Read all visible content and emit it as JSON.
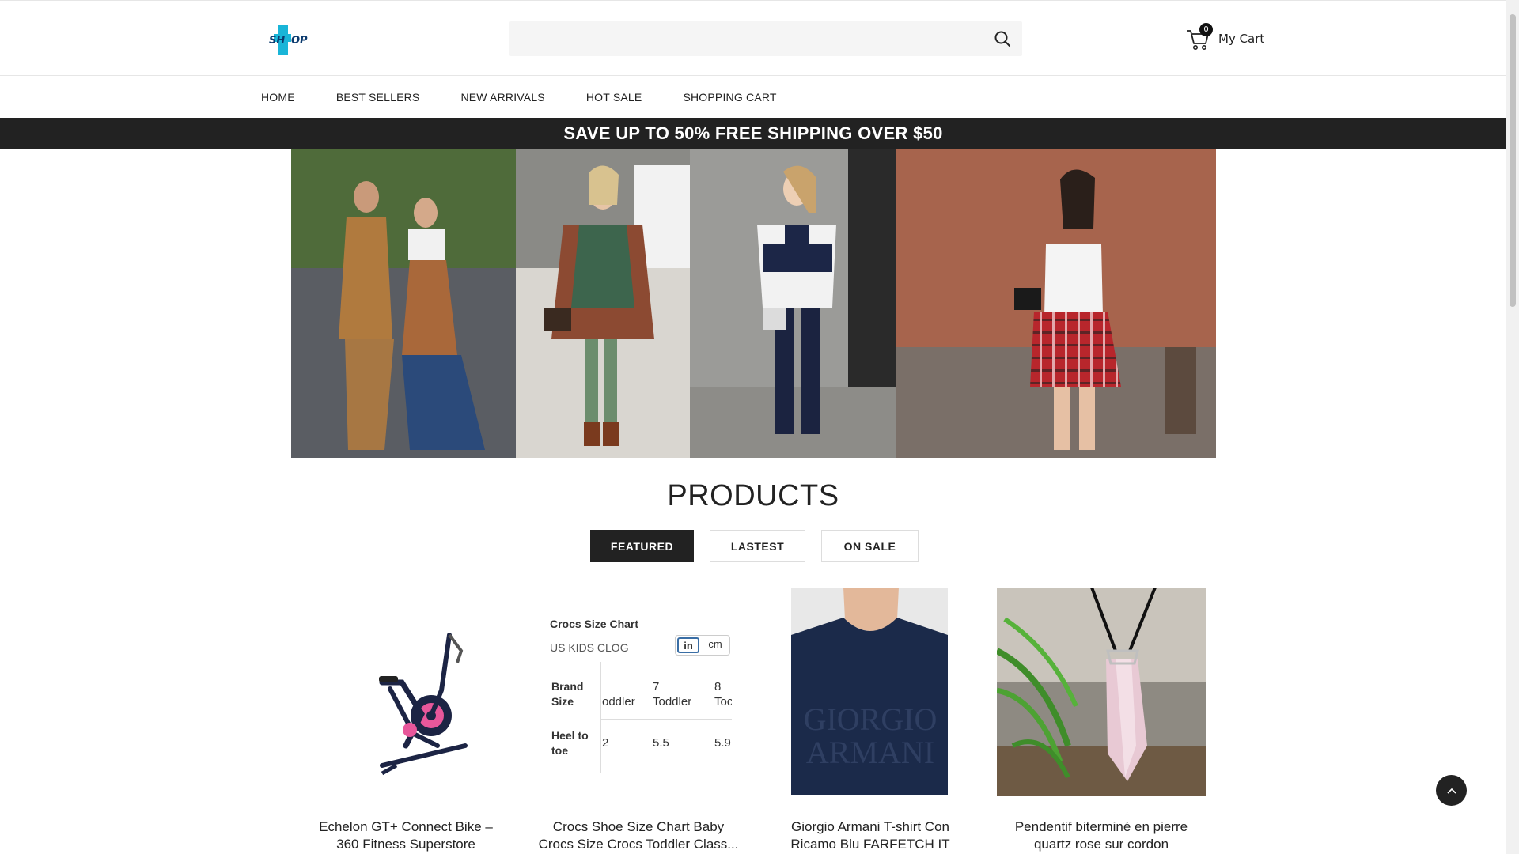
{
  "header": {
    "logo_alt": "SHOP",
    "search": {
      "placeholder": "",
      "value": ""
    },
    "cart": {
      "count": "0",
      "label": "My Cart"
    }
  },
  "nav": {
    "items": [
      {
        "label": "HOME"
      },
      {
        "label": "BEST SELLERS"
      },
      {
        "label": "NEW ARRIVALS"
      },
      {
        "label": "HOT SALE"
      },
      {
        "label": "SHOPPING CART"
      }
    ]
  },
  "promo": {
    "text": "SAVE UP TO 50% FREE SHIPPING OVER $50"
  },
  "products": {
    "title": "PRODUCTS",
    "tabs": [
      {
        "label": "FEATURED",
        "active": true
      },
      {
        "label": "LASTEST",
        "active": false
      },
      {
        "label": "ON SALE",
        "active": false
      }
    ],
    "items": [
      {
        "name_line1": "Echelon GT+ Connect Bike –",
        "name_line2": "360 Fitness Superstore",
        "rating": "★★★★★"
      },
      {
        "name_line1": "Crocs Shoe Size Chart Baby",
        "name_line2": "Crocs Size Crocs Toddler Class...",
        "rating": "★★★★★"
      },
      {
        "name_line1": "Giorgio Armani T-shirt Con",
        "name_line2": "Ricamo Blu FARFETCH IT",
        "rating": "★★★★★"
      },
      {
        "name_line1": "Pendentif biterminé en pierre",
        "name_line2": "quartz rose sur cordon",
        "rating": "★★★★★"
      }
    ],
    "size_chart": {
      "title": "Crocs Size Chart",
      "subtitle": "US KIDS CLOG",
      "unit_in": "in",
      "unit_cm": "cm",
      "row1_label_1": "Brand",
      "row1_label_2": "Size",
      "row2_label_1": "Heel to",
      "row2_label_2": "toe",
      "col1_top": "",
      "col1_bottom": "oddler",
      "col2_top": "7",
      "col2_bottom": "Toddler",
      "col3_top": "8",
      "col3_bottom": "Toc",
      "val1": "2",
      "val2": "5.5",
      "val3": "5.9"
    },
    "tshirt_print_1": "GIORGIO",
    "tshirt_print_2": "ARMANI"
  },
  "colors": {
    "promo_bg": "#222222",
    "tab_active_bg": "#222222",
    "star": "#f5b400",
    "logo_cyan": "#19b5d8",
    "logo_dark": "#0b3a6e"
  }
}
